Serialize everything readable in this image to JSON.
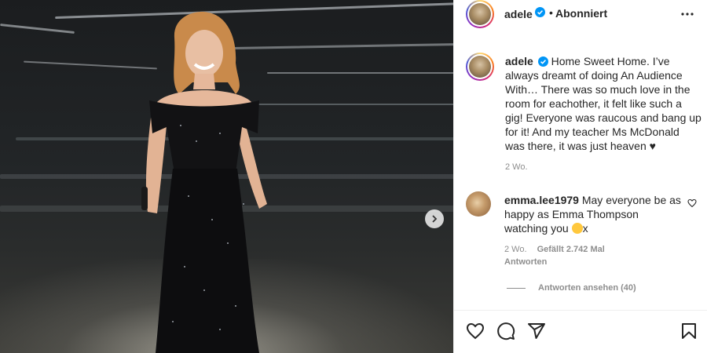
{
  "post": {
    "author": "adele",
    "follow_status": "Abonniert",
    "separator": "•",
    "caption": "Home Sweet Home. I’ve always dreamt of doing An Audience With… There was so much love in the room for eachother, it felt like such a gig! Everyone was raucous and bang up for it! And my teacher Ms McDonald was there, it was just heaven ♥",
    "time": "2 Wo."
  },
  "comment": {
    "author": "emma.lee1979",
    "text": "May everyone be as happy as Emma Thompson watching you ",
    "text_suffix": "x",
    "time": "2 Wo.",
    "likes": "Gefällt 2.742 Mal",
    "reply_label": "Antworten",
    "view_replies": "Antworten ansehen (40)"
  },
  "icons": {
    "verified": "verified-badge-icon",
    "more": "more-options-icon",
    "next": "chevron-right-icon",
    "like": "heart-icon",
    "comment": "comment-bubble-icon",
    "share": "paper-plane-icon",
    "save": "bookmark-icon"
  },
  "colors": {
    "verified": "#0095f6",
    "muted": "#8e8e8e",
    "text": "#262626"
  }
}
